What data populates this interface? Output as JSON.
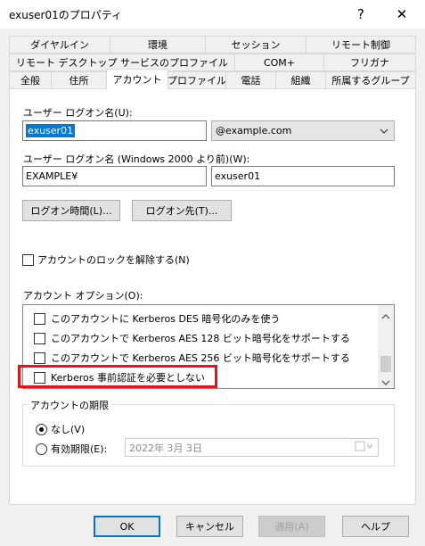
{
  "window": {
    "title": "exuser01のプロパティ",
    "help_glyph": "?",
    "close_glyph": "✕"
  },
  "tabs": {
    "row1": [
      "ダイヤルイン",
      "環境",
      "セッション",
      "リモート制御"
    ],
    "row2": [
      "リモート デスクトップ サービスのプロファイル",
      "COM+",
      "フリガナ"
    ],
    "row3": [
      "全般",
      "住所",
      "アカウント",
      "プロファイル",
      "電話",
      "組織",
      "所属するグループ"
    ],
    "active": "アカウント"
  },
  "account": {
    "logon_name_label": "ユーザー ログオン名(U):",
    "logon_name_value": "exuser01",
    "domain_value": "@example.com",
    "pre2000_label": "ユーザー ログオン名 (Windows 2000 より前)(W):",
    "pre2000_domain": "EXAMPLE¥",
    "pre2000_user": "exuser01",
    "logon_hours_button": "ログオン時間(L)...",
    "logon_to_button": "ログオン先(T)...",
    "unlock_label": "アカウントのロックを解除する(N)",
    "options_label": "アカウント オプション(O):",
    "options": [
      "このアカウントに Kerberos DES 暗号化のみを使う",
      "このアカウントで Kerberos AES 128 ビット暗号化をサポートする",
      "このアカウントで Kerberos AES 256 ビット暗号化をサポートする",
      "Kerberos 事前認証を必要としない"
    ],
    "expiry_group_label": "アカウントの期限",
    "expiry_never": "なし(V)",
    "expiry_end": "有効期限(E):",
    "expiry_date": "2022年  3月  3日"
  },
  "footer": {
    "ok": "OK",
    "cancel": "キャンセル",
    "apply": "適用(A)",
    "help": "ヘルプ"
  },
  "colors": {
    "highlight": "#0078d7",
    "callout": "#e8121d"
  }
}
